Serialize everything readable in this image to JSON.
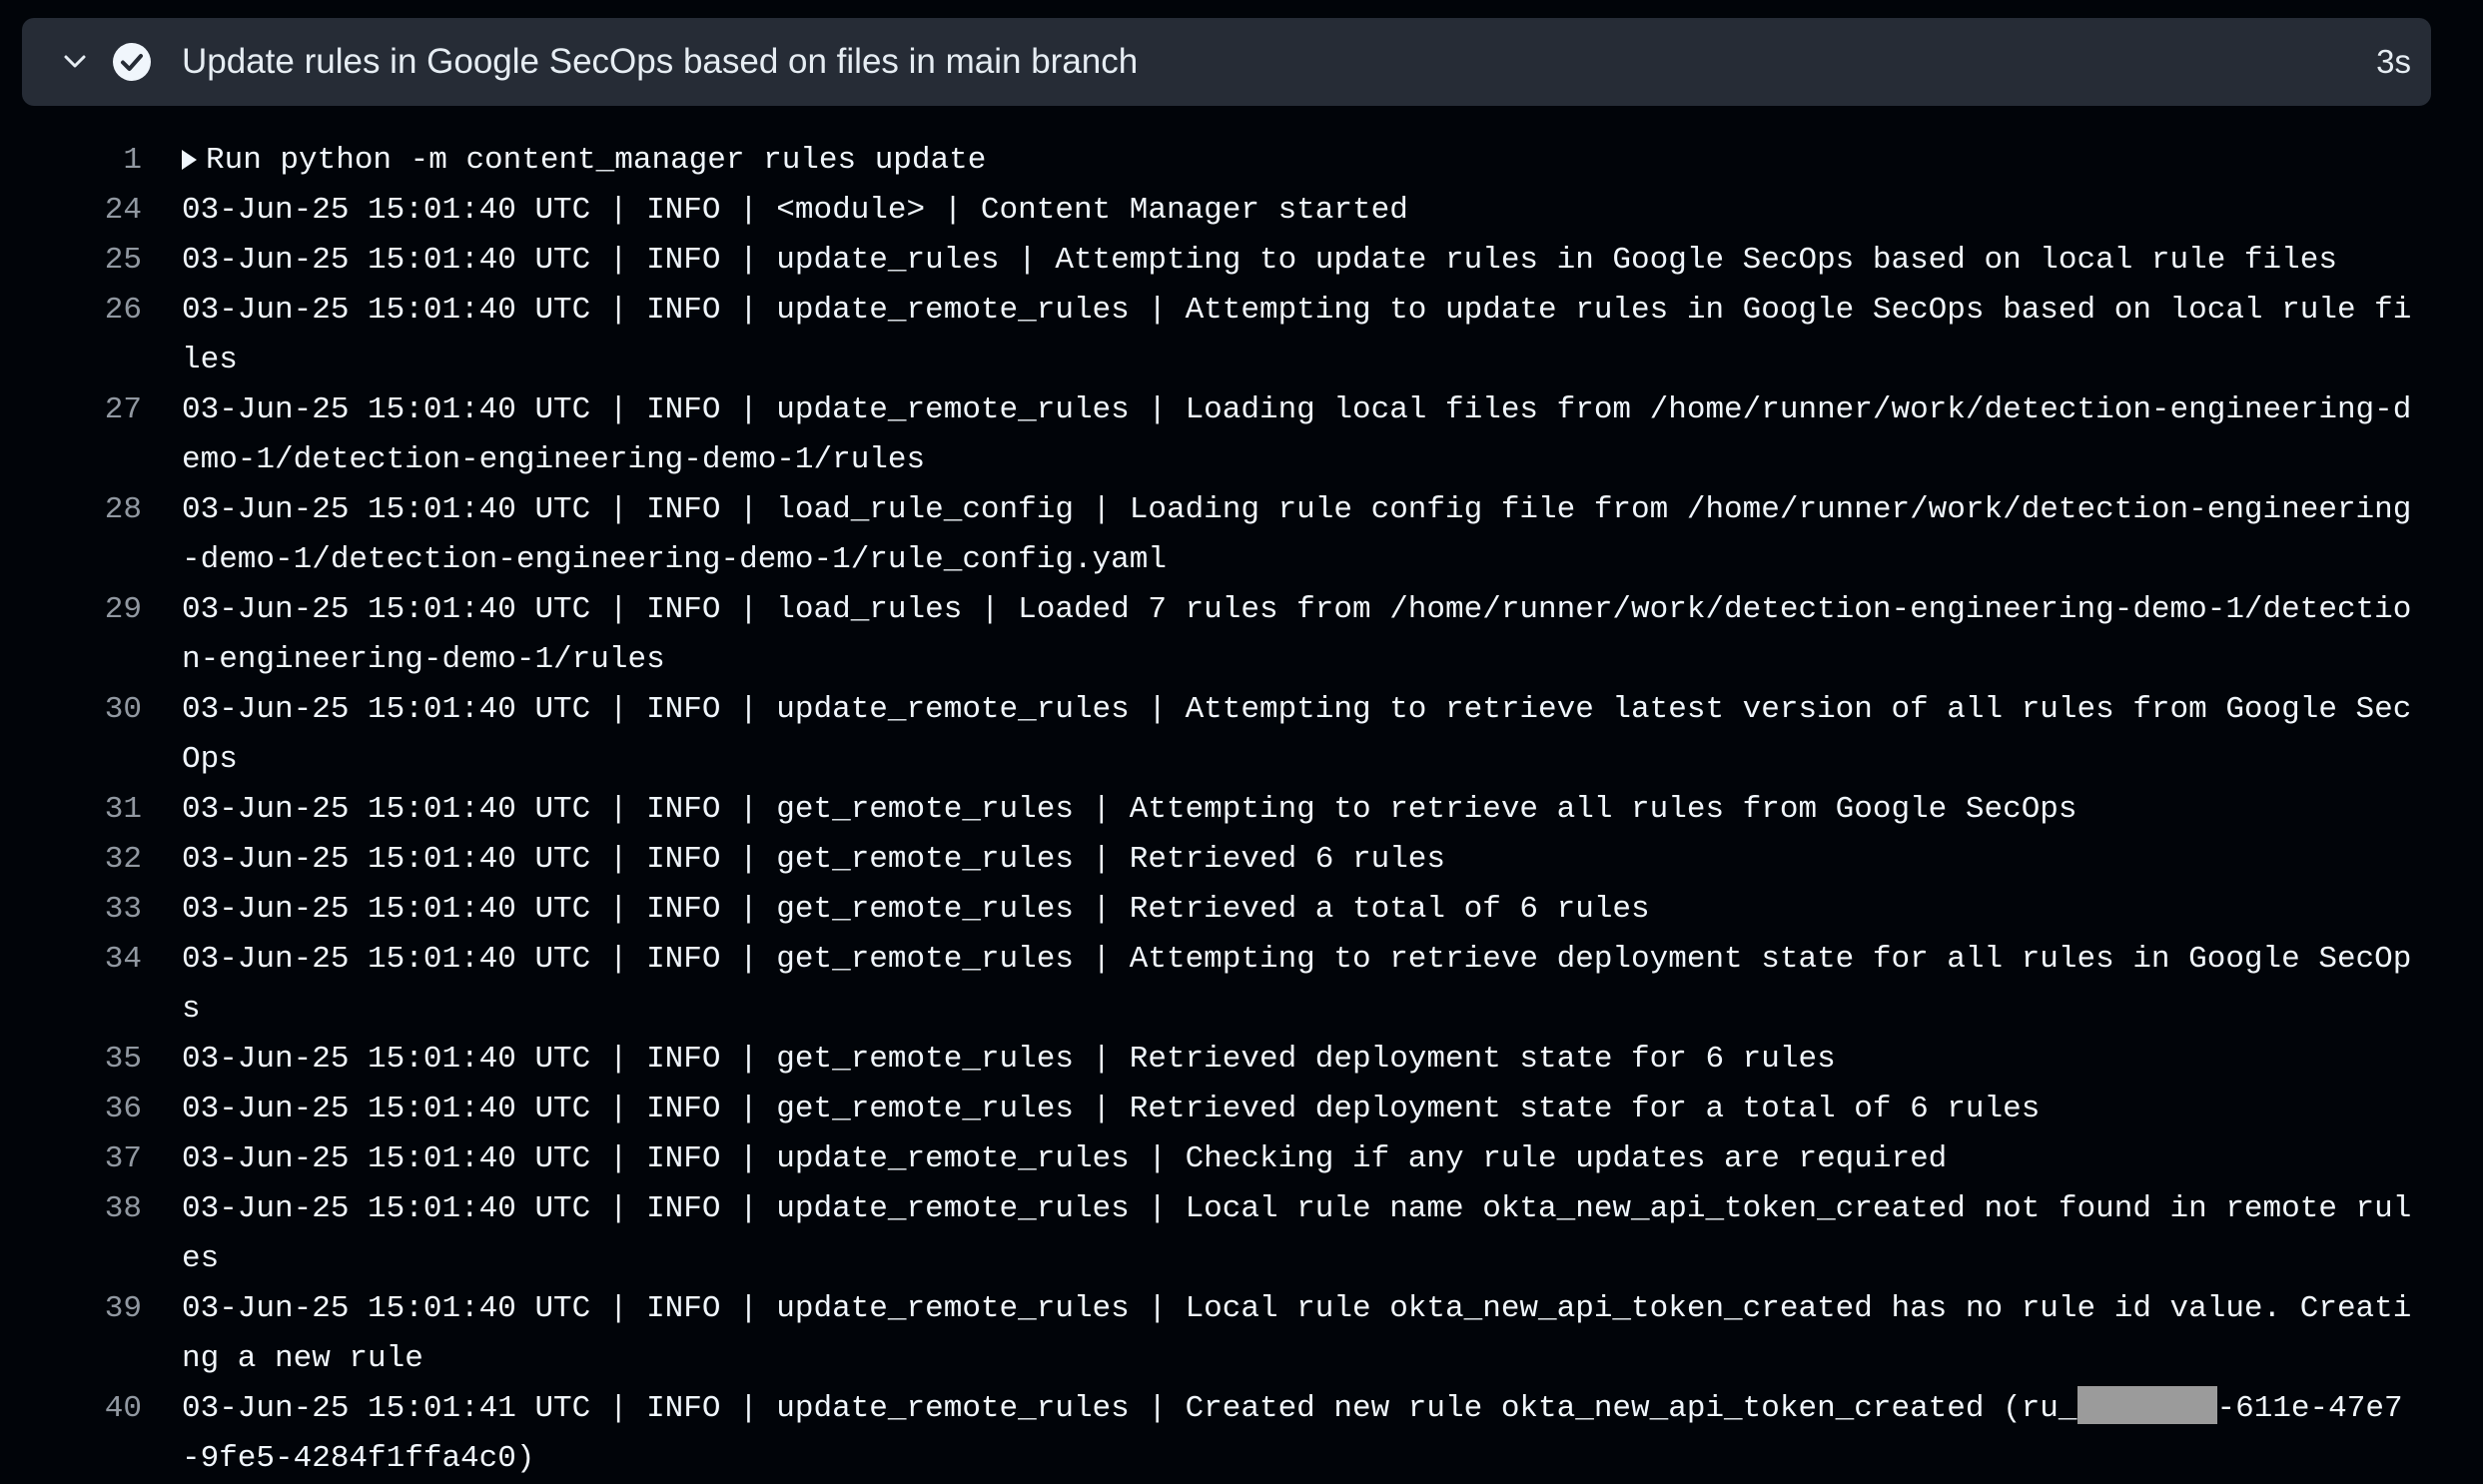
{
  "step": {
    "title": "Update rules in Google SecOps based on files in main branch",
    "duration": "3s",
    "status": "success"
  },
  "colors": {
    "background": "#010409",
    "header_bg": "#262c36",
    "line_number": "#9198a1",
    "text": "#f0f6fc",
    "redaction": "#9b9b9b"
  },
  "icons": {
    "chevron": "chevron-down-icon",
    "status": "check-circle-icon"
  },
  "log": {
    "first": {
      "num": "1",
      "text": "Run python -m content_manager rules update"
    },
    "lines": [
      {
        "num": "24",
        "text": "03-Jun-25 15:01:40 UTC | INFO | <module> | Content Manager started"
      },
      {
        "num": "25",
        "text": "03-Jun-25 15:01:40 UTC | INFO | update_rules | Attempting to update rules in Google SecOps based on local rule files"
      },
      {
        "num": "26",
        "text": "03-Jun-25 15:01:40 UTC | INFO | update_remote_rules | Attempting to update rules in Google SecOps based on local rule files"
      },
      {
        "num": "27",
        "text": "03-Jun-25 15:01:40 UTC | INFO | update_remote_rules | Loading local files from /home/runner/work/detection-engineering-demo-1/detection-engineering-demo-1/rules"
      },
      {
        "num": "28",
        "text": "03-Jun-25 15:01:40 UTC | INFO | load_rule_config | Loading rule config file from /home/runner/work/detection-engineering-demo-1/detection-engineering-demo-1/rule_config.yaml"
      },
      {
        "num": "29",
        "text": "03-Jun-25 15:01:40 UTC | INFO | load_rules | Loaded 7 rules from /home/runner/work/detection-engineering-demo-1/detection-engineering-demo-1/rules"
      },
      {
        "num": "30",
        "text": "03-Jun-25 15:01:40 UTC | INFO | update_remote_rules | Attempting to retrieve latest version of all rules from Google SecOps"
      },
      {
        "num": "31",
        "text": "03-Jun-25 15:01:40 UTC | INFO | get_remote_rules | Attempting to retrieve all rules from Google SecOps"
      },
      {
        "num": "32",
        "text": "03-Jun-25 15:01:40 UTC | INFO | get_remote_rules | Retrieved 6 rules"
      },
      {
        "num": "33",
        "text": "03-Jun-25 15:01:40 UTC | INFO | get_remote_rules | Retrieved a total of 6 rules"
      },
      {
        "num": "34",
        "text": "03-Jun-25 15:01:40 UTC | INFO | get_remote_rules | Attempting to retrieve deployment state for all rules in Google SecOps"
      },
      {
        "num": "35",
        "text": "03-Jun-25 15:01:40 UTC | INFO | get_remote_rules | Retrieved deployment state for 6 rules"
      },
      {
        "num": "36",
        "text": "03-Jun-25 15:01:40 UTC | INFO | get_remote_rules | Retrieved deployment state for a total of 6 rules"
      },
      {
        "num": "37",
        "text": "03-Jun-25 15:01:40 UTC | INFO | update_remote_rules | Checking if any rule updates are required"
      },
      {
        "num": "38",
        "text": "03-Jun-25 15:01:40 UTC | INFO | update_remote_rules | Local rule name okta_new_api_token_created not found in remote rules"
      },
      {
        "num": "39",
        "text": "03-Jun-25 15:01:40 UTC | INFO | update_remote_rules | Local rule okta_new_api_token_created has no rule id value. Creating a new rule"
      }
    ],
    "last": {
      "num": "40",
      "text_before": "03-Jun-25 15:01:41 UTC | INFO | update_remote_rules | Created new rule okta_new_api_token_created (ru_",
      "text_after": "-611e-47e7-9fe5-4284f1ffa4c0)"
    }
  }
}
